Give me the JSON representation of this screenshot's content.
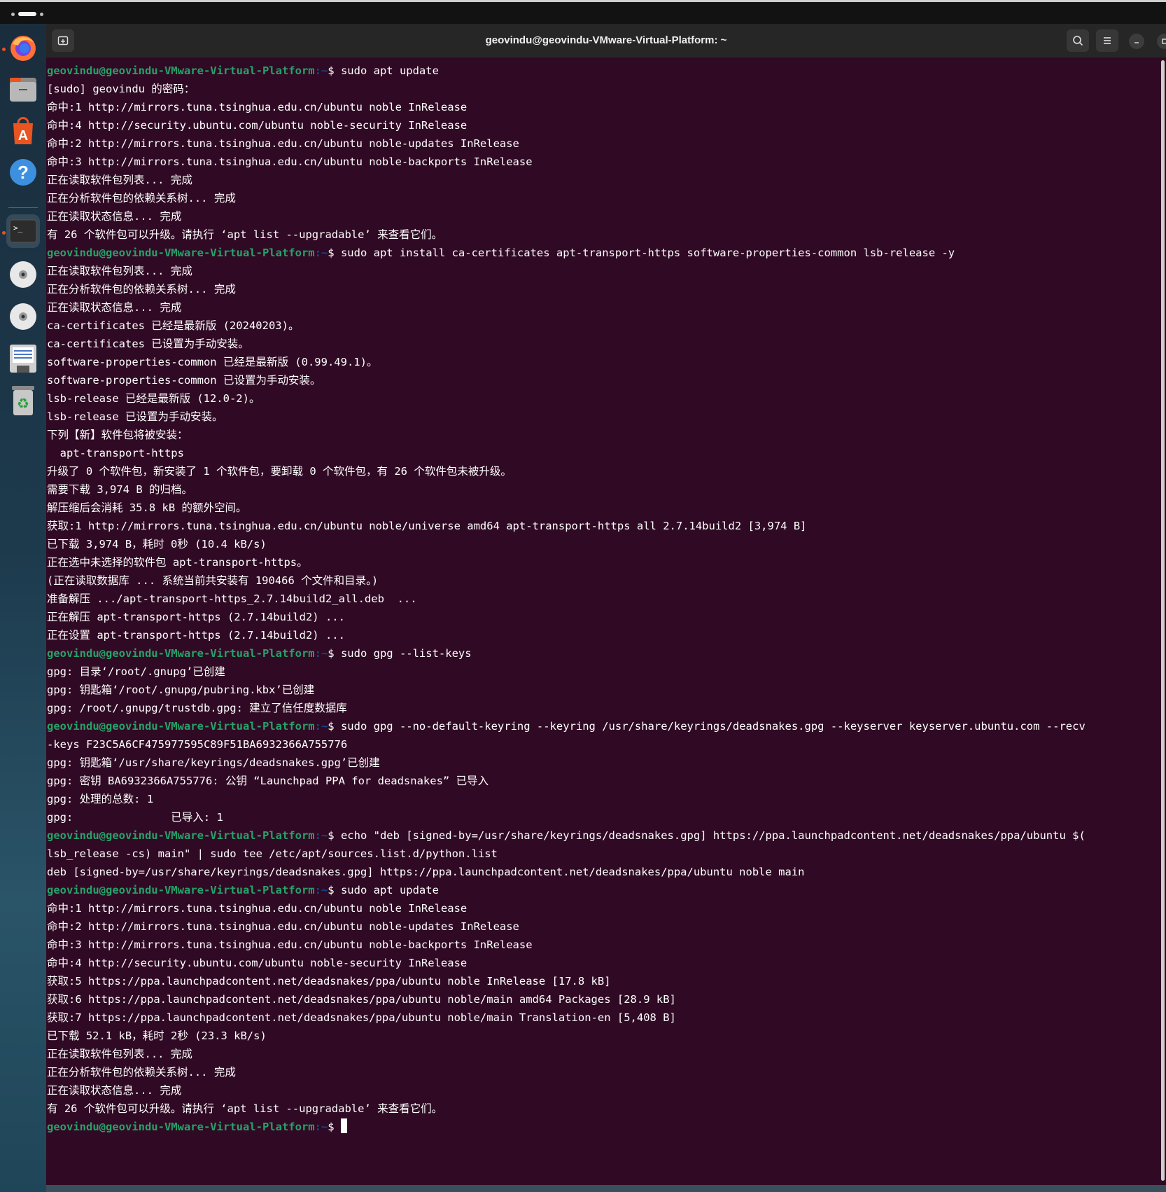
{
  "window": {
    "title": "geovindu@geovindu-VMware-Virtual-Platform: ~"
  },
  "dock": {
    "items": [
      {
        "name": "Firefox",
        "icon": "firefox-icon",
        "running": true
      },
      {
        "name": "Files",
        "icon": "files-icon",
        "running": false
      },
      {
        "name": "App Center",
        "icon": "app-center-icon",
        "running": false
      },
      {
        "name": "Help",
        "icon": "help-icon",
        "running": false
      },
      {
        "name": "Terminal",
        "icon": "terminal-icon",
        "running": true
      },
      {
        "name": "Disc 1",
        "icon": "disc-icon",
        "running": false
      },
      {
        "name": "Disc 2",
        "icon": "disc-icon",
        "running": false
      },
      {
        "name": "Floppy / Save",
        "icon": "floppy-icon",
        "running": false
      },
      {
        "name": "Trash",
        "icon": "trash-icon",
        "running": false
      }
    ]
  },
  "terminal": {
    "prompt_user": "geovindu@geovindu-VMware-Virtual-Platform",
    "prompt_path": ":~",
    "prompt_dollar": "$ ",
    "lines": [
      {
        "type": "cmd",
        "text": "sudo apt update"
      },
      {
        "type": "out",
        "text": "[sudo] geovindu 的密码："
      },
      {
        "type": "out",
        "text": "命中:1 http://mirrors.tuna.tsinghua.edu.cn/ubuntu noble InRelease"
      },
      {
        "type": "out",
        "text": "命中:4 http://security.ubuntu.com/ubuntu noble-security InRelease"
      },
      {
        "type": "out",
        "text": "命中:2 http://mirrors.tuna.tsinghua.edu.cn/ubuntu noble-updates InRelease"
      },
      {
        "type": "out",
        "text": "命中:3 http://mirrors.tuna.tsinghua.edu.cn/ubuntu noble-backports InRelease"
      },
      {
        "type": "out",
        "text": "正在读取软件包列表... 完成"
      },
      {
        "type": "out",
        "text": "正在分析软件包的依赖关系树... 完成"
      },
      {
        "type": "out",
        "text": "正在读取状态信息... 完成"
      },
      {
        "type": "out",
        "text": "有 26 个软件包可以升级。请执行 ‘apt list --upgradable’ 来查看它们。"
      },
      {
        "type": "cmd",
        "text": "sudo apt install ca-certificates apt-transport-https software-properties-common lsb-release -y"
      },
      {
        "type": "out",
        "text": "正在读取软件包列表... 完成"
      },
      {
        "type": "out",
        "text": "正在分析软件包的依赖关系树... 完成"
      },
      {
        "type": "out",
        "text": "正在读取状态信息... 完成"
      },
      {
        "type": "out",
        "text": "ca-certificates 已经是最新版 (20240203)。"
      },
      {
        "type": "out",
        "text": "ca-certificates 已设置为手动安装。"
      },
      {
        "type": "out",
        "text": "software-properties-common 已经是最新版 (0.99.49.1)。"
      },
      {
        "type": "out",
        "text": "software-properties-common 已设置为手动安装。"
      },
      {
        "type": "out",
        "text": "lsb-release 已经是最新版 (12.0-2)。"
      },
      {
        "type": "out",
        "text": "lsb-release 已设置为手动安装。"
      },
      {
        "type": "out",
        "text": "下列【新】软件包将被安装："
      },
      {
        "type": "out",
        "text": "  apt-transport-https"
      },
      {
        "type": "out",
        "text": "升级了 0 个软件包，新安装了 1 个软件包，要卸载 0 个软件包，有 26 个软件包未被升级。"
      },
      {
        "type": "out",
        "text": "需要下载 3,974 B 的归档。"
      },
      {
        "type": "out",
        "text": "解压缩后会消耗 35.8 kB 的额外空间。"
      },
      {
        "type": "out",
        "text": "获取:1 http://mirrors.tuna.tsinghua.edu.cn/ubuntu noble/universe amd64 apt-transport-https all 2.7.14build2 [3,974 B]"
      },
      {
        "type": "out",
        "text": "已下载 3,974 B，耗时 0秒 (10.4 kB/s)"
      },
      {
        "type": "out",
        "text": "正在选中未选择的软件包 apt-transport-https。"
      },
      {
        "type": "out",
        "text": "(正在读取数据库 ... 系统当前共安装有 190466 个文件和目录。)"
      },
      {
        "type": "out",
        "text": "准备解压 .../apt-transport-https_2.7.14build2_all.deb  ..."
      },
      {
        "type": "out",
        "text": "正在解压 apt-transport-https (2.7.14build2) ..."
      },
      {
        "type": "out",
        "text": "正在设置 apt-transport-https (2.7.14build2) ..."
      },
      {
        "type": "cmd",
        "text": "sudo gpg --list-keys"
      },
      {
        "type": "out",
        "text": "gpg: 目录‘/root/.gnupg’已创建"
      },
      {
        "type": "out",
        "text": "gpg: 钥匙箱‘/root/.gnupg/pubring.kbx’已创建"
      },
      {
        "type": "out",
        "text": "gpg: /root/.gnupg/trustdb.gpg: 建立了信任度数据库"
      },
      {
        "type": "cmd",
        "text": "sudo gpg --no-default-keyring --keyring /usr/share/keyrings/deadsnakes.gpg --keyserver keyserver.ubuntu.com --recv"
      },
      {
        "type": "out",
        "text": "-keys F23C5A6CF475977595C89F51BA6932366A755776"
      },
      {
        "type": "out",
        "text": "gpg: 钥匙箱‘/usr/share/keyrings/deadsnakes.gpg’已创建"
      },
      {
        "type": "out",
        "text": "gpg: 密钥 BA6932366A755776: 公钥 “Launchpad PPA for deadsnakes” 已导入"
      },
      {
        "type": "out",
        "text": "gpg: 处理的总数: 1"
      },
      {
        "type": "out",
        "text": "gpg:               已导入: 1"
      },
      {
        "type": "cmd",
        "text": "echo \"deb [signed-by=/usr/share/keyrings/deadsnakes.gpg] https://ppa.launchpadcontent.net/deadsnakes/ppa/ubuntu $("
      },
      {
        "type": "out",
        "text": "lsb_release -cs) main\" | sudo tee /etc/apt/sources.list.d/python.list"
      },
      {
        "type": "out",
        "text": "deb [signed-by=/usr/share/keyrings/deadsnakes.gpg] https://ppa.launchpadcontent.net/deadsnakes/ppa/ubuntu noble main"
      },
      {
        "type": "cmd",
        "text": "sudo apt update"
      },
      {
        "type": "out",
        "text": "命中:1 http://mirrors.tuna.tsinghua.edu.cn/ubuntu noble InRelease"
      },
      {
        "type": "out",
        "text": "命中:2 http://mirrors.tuna.tsinghua.edu.cn/ubuntu noble-updates InRelease"
      },
      {
        "type": "out",
        "text": "命中:3 http://mirrors.tuna.tsinghua.edu.cn/ubuntu noble-backports InRelease"
      },
      {
        "type": "out",
        "text": "命中:4 http://security.ubuntu.com/ubuntu noble-security InRelease"
      },
      {
        "type": "out",
        "text": "获取:5 https://ppa.launchpadcontent.net/deadsnakes/ppa/ubuntu noble InRelease [17.8 kB]"
      },
      {
        "type": "out",
        "text": "获取:6 https://ppa.launchpadcontent.net/deadsnakes/ppa/ubuntu noble/main amd64 Packages [28.9 kB]"
      },
      {
        "type": "out",
        "text": "获取:7 https://ppa.launchpadcontent.net/deadsnakes/ppa/ubuntu noble/main Translation-en [5,408 B]"
      },
      {
        "type": "out",
        "text": "已下载 52.1 kB，耗时 2秒 (23.3 kB/s)"
      },
      {
        "type": "out",
        "text": "正在读取软件包列表... 完成"
      },
      {
        "type": "out",
        "text": "正在分析软件包的依赖关系树... 完成"
      },
      {
        "type": "out",
        "text": "正在读取状态信息... 完成"
      },
      {
        "type": "out",
        "text": "有 26 个软件包可以升级。请执行 ‘apt list --upgradable’ 来查看它们。"
      },
      {
        "type": "prompt",
        "text": ""
      }
    ]
  },
  "colors": {
    "terminal_bg": "#300a24",
    "prompt_user": "#26a269",
    "prompt_path": "#12488b",
    "text": "#ffffff"
  }
}
